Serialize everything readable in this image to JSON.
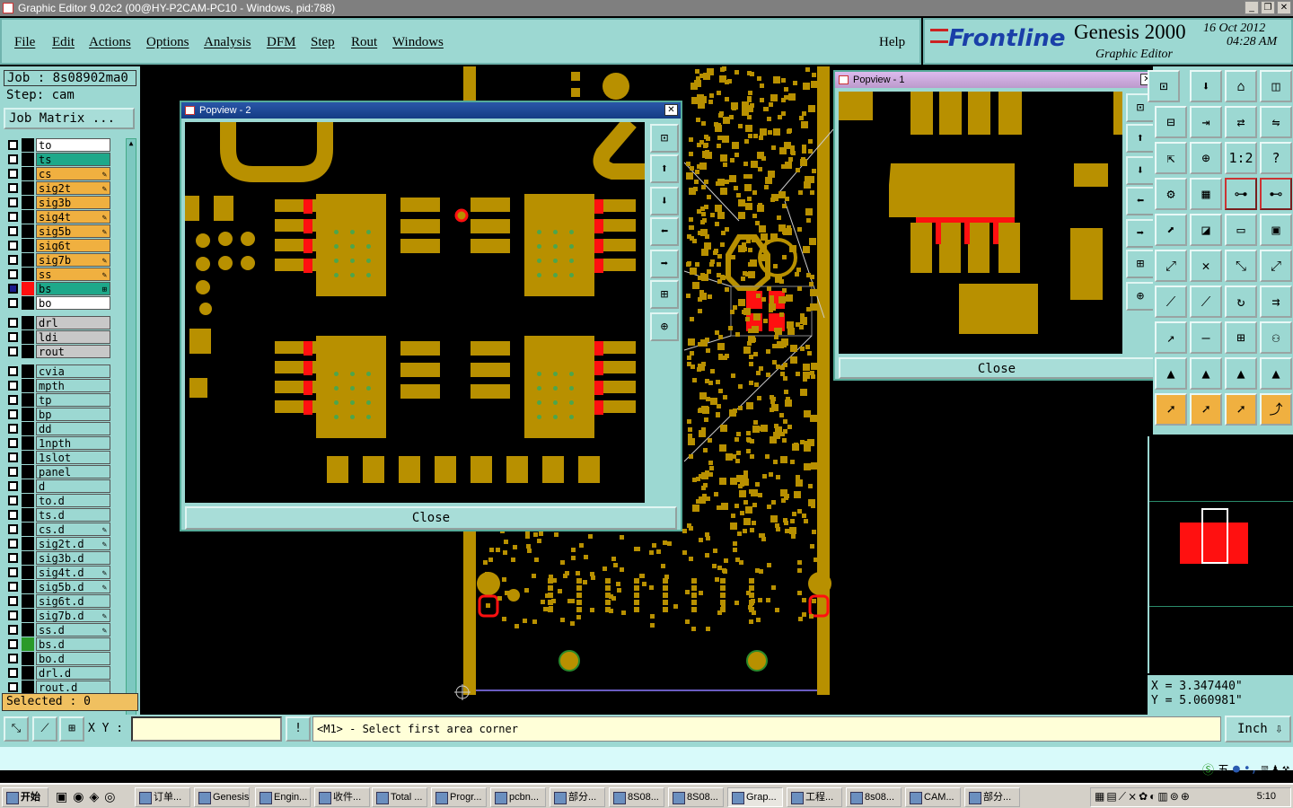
{
  "window": {
    "title": "Graphic Editor 9.02c2 (00@HY-P2CAM-PC10 - Windows, pid:788)",
    "controls": [
      "_",
      "❐",
      "✕"
    ]
  },
  "menu": [
    "File",
    "Edit",
    "Actions",
    "Options",
    "Analysis",
    "DFM",
    "Step",
    "Rout",
    "Windows"
  ],
  "help_label": "Help",
  "brand": {
    "logo": "Frontline",
    "product": "Genesis 2000",
    "subtitle": "Graphic Editor",
    "date": "16 Oct 2012",
    "time": "04:28 AM"
  },
  "job": {
    "job_label": "Job : 8s08902ma0",
    "step_label": "Step: cam",
    "matrix_button": "Job Matrix ..."
  },
  "layers": [
    {
      "name": "to",
      "color": "#ffffff",
      "edit": ""
    },
    {
      "name": "ts",
      "color": "#1ea88a",
      "edit": ""
    },
    {
      "name": "cs",
      "color": "#f0b040",
      "edit": "✎"
    },
    {
      "name": "sig2t",
      "color": "#f0b040",
      "edit": "✎"
    },
    {
      "name": "sig3b",
      "color": "#f0b040",
      "edit": ""
    },
    {
      "name": "sig4t",
      "color": "#f0b040",
      "edit": "✎"
    },
    {
      "name": "sig5b",
      "color": "#f0b040",
      "edit": "✎"
    },
    {
      "name": "sig6t",
      "color": "#f0b040",
      "edit": ""
    },
    {
      "name": "sig7b",
      "color": "#f0b040",
      "edit": "✎"
    },
    {
      "name": "ss",
      "color": "#f0b040",
      "edit": "✎"
    },
    {
      "name": "bs",
      "color": "#1ea88a",
      "edit": "⊞",
      "active": true
    },
    {
      "name": "bo",
      "color": "#ffffff",
      "edit": ""
    },
    {
      "name": "drl",
      "color": "#c8c8c8",
      "edit": ""
    },
    {
      "name": "ldi",
      "color": "#c8c8c8",
      "edit": ""
    },
    {
      "name": "rout",
      "color": "#c8c8c8",
      "edit": ""
    },
    {
      "name": "cvia",
      "color": "#9cd8d2",
      "edit": ""
    },
    {
      "name": "mpth",
      "color": "#9cd8d2",
      "edit": ""
    },
    {
      "name": "tp",
      "color": "#9cd8d2",
      "edit": ""
    },
    {
      "name": "bp",
      "color": "#9cd8d2",
      "edit": ""
    },
    {
      "name": "dd",
      "color": "#9cd8d2",
      "edit": ""
    },
    {
      "name": "1npth",
      "color": "#9cd8d2",
      "edit": ""
    },
    {
      "name": "1slot",
      "color": "#9cd8d2",
      "edit": ""
    },
    {
      "name": "panel",
      "color": "#9cd8d2",
      "edit": ""
    },
    {
      "name": "d",
      "color": "#9cd8d2",
      "edit": ""
    },
    {
      "name": "to.d",
      "color": "#9cd8d2",
      "edit": ""
    },
    {
      "name": "ts.d",
      "color": "#9cd8d2",
      "edit": ""
    },
    {
      "name": "cs.d",
      "color": "#9cd8d2",
      "edit": "✎"
    },
    {
      "name": "sig2t.d",
      "color": "#9cd8d2",
      "edit": "✎"
    },
    {
      "name": "sig3b.d",
      "color": "#9cd8d2",
      "edit": ""
    },
    {
      "name": "sig4t.d",
      "color": "#9cd8d2",
      "edit": "✎"
    },
    {
      "name": "sig5b.d",
      "color": "#9cd8d2",
      "edit": "✎"
    },
    {
      "name": "sig6t.d",
      "color": "#9cd8d2",
      "edit": ""
    },
    {
      "name": "sig7b.d",
      "color": "#9cd8d2",
      "edit": "✎"
    },
    {
      "name": "ss.d",
      "color": "#9cd8d2",
      "edit": "✎"
    },
    {
      "name": "bs.d",
      "color": "#9cd8d2",
      "edit": ""
    },
    {
      "name": "bo.d",
      "color": "#9cd8d2",
      "edit": ""
    },
    {
      "name": "drl.d",
      "color": "#9cd8d2",
      "edit": ""
    },
    {
      "name": "rout.d",
      "color": "#9cd8d2",
      "edit": ""
    }
  ],
  "selected_label": "Selected : 0",
  "popview2": {
    "title": "Popview - 2",
    "close": "Close",
    "close_x": "✕"
  },
  "popview1": {
    "title": "Popview - 1",
    "close": "Close",
    "close_x": "✕"
  },
  "coords": {
    "x": "X = 3.347440\"",
    "y": "Y = 5.060981\""
  },
  "xy_label": "X Y :",
  "xy_value": "",
  "message": "<M1> - Select first area corner",
  "unit": "Inch",
  "taskbar": {
    "start": "开始",
    "clock": "5:10",
    "items": [
      "订单...",
      "Genesis",
      "Engin...",
      "收件...",
      "Total ...",
      "Progr...",
      "pcbn...",
      "部分...",
      "8S08...",
      "8S08...",
      "Grap...",
      "工程...",
      "8s08...",
      "CAM...",
      "部分..."
    ],
    "active_item": "Grap..."
  },
  "ime": {
    "mode": "五"
  }
}
